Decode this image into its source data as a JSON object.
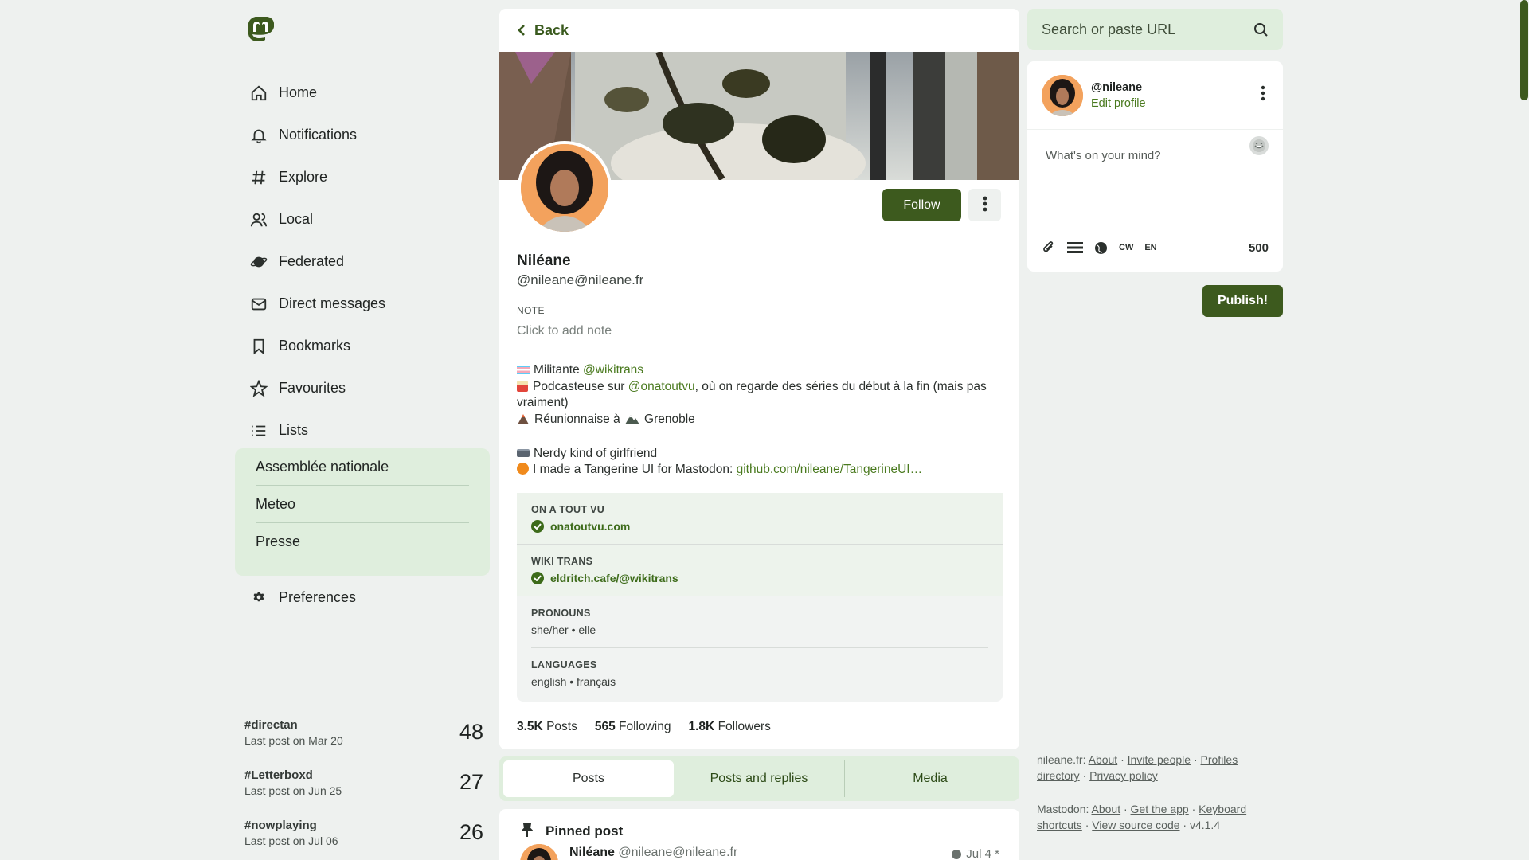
{
  "nav": {
    "items": [
      {
        "label": "Home",
        "icon": "home-icon"
      },
      {
        "label": "Notifications",
        "icon": "bell-icon"
      },
      {
        "label": "Explore",
        "icon": "hashtag-icon"
      },
      {
        "label": "Local",
        "icon": "users-icon"
      },
      {
        "label": "Federated",
        "icon": "globe-icon"
      },
      {
        "label": "Direct messages",
        "icon": "mail-icon"
      },
      {
        "label": "Bookmarks",
        "icon": "bookmark-icon"
      },
      {
        "label": "Favourites",
        "icon": "star-icon"
      },
      {
        "label": "Lists",
        "icon": "list-icon"
      }
    ],
    "lists": [
      "Assemblée nationale",
      "Meteo",
      "Presse"
    ],
    "preferences": "Preferences"
  },
  "trends": [
    {
      "tag": "#directan",
      "sub": "Last post on Mar 20",
      "count": "48"
    },
    {
      "tag": "#Letterboxd",
      "sub": "Last post on Jun 25",
      "count": "27"
    },
    {
      "tag": "#nowplaying",
      "sub": "Last post on Jul 06",
      "count": "26"
    }
  ],
  "profile": {
    "back": "Back",
    "follow": "Follow",
    "name": "Niléane",
    "handle": "@nileane@nileane.fr",
    "note_label": "NOTE",
    "note_placeholder": "Click to add note",
    "bio": {
      "l1_pre": "Militante ",
      "l1_link": "@wikitrans",
      "l2_pre": "Podcasteuse sur ",
      "l2_link": "@onatoutvu",
      "l2_post": ", où on regarde des séries du début à la fin (mais pas vraiment)",
      "l3_a": "Réunionnaise à ",
      "l3_b": "Grenoble",
      "l4": "Nerdy kind of girlfriend",
      "l5_pre": "I made a Tangerine UI for Mastodon: ",
      "l5_link": "github.com/nileane/TangerineUI…"
    },
    "fields": [
      {
        "key": "ON A TOUT VU",
        "value": "onatoutvu.com",
        "verified": true
      },
      {
        "key": "WIKI TRANS",
        "value": "eldritch.cafe/@wikitrans",
        "verified": true
      },
      {
        "key": "PRONOUNS",
        "value": "she/her • elle",
        "verified": false
      },
      {
        "key": "LANGUAGES",
        "value": "english • français",
        "verified": false
      }
    ],
    "stats": {
      "posts_num": "3.5K",
      "posts_label": "Posts",
      "following_num": "565",
      "following_label": "Following",
      "followers_num": "1.8K",
      "followers_label": "Followers"
    },
    "tabs": [
      "Posts",
      "Posts and replies",
      "Media"
    ],
    "active_tab": "Posts",
    "pinned": {
      "label": "Pinned post",
      "author_name": "Niléane",
      "author_handle": "@nileane@nileane.fr",
      "date": "Jul 4 *"
    }
  },
  "search": {
    "placeholder": "Search or paste URL"
  },
  "composer": {
    "handle": "@nileane",
    "edit": "Edit profile",
    "placeholder": "What's on your mind?",
    "cw": "CW",
    "lang": "EN",
    "count": "500",
    "publish": "Publish!"
  },
  "footer": {
    "instance": "nileane.fr:",
    "about": "About",
    "invite": "Invite people",
    "profiles": "Profiles",
    "directory": "directory",
    "privacy": "Privacy policy",
    "mastodon": "Mastodon:",
    "about2": "About",
    "getapp": "Get the app",
    "keyboard": "Keyboard",
    "shortcuts": "shortcuts",
    "source": "View source code",
    "version": "v4.1.4"
  },
  "colors": {
    "accent": "#3d5a1e",
    "accent_light": "#dfeedd",
    "link": "#4a7a1f",
    "background": "#eef1ef"
  }
}
